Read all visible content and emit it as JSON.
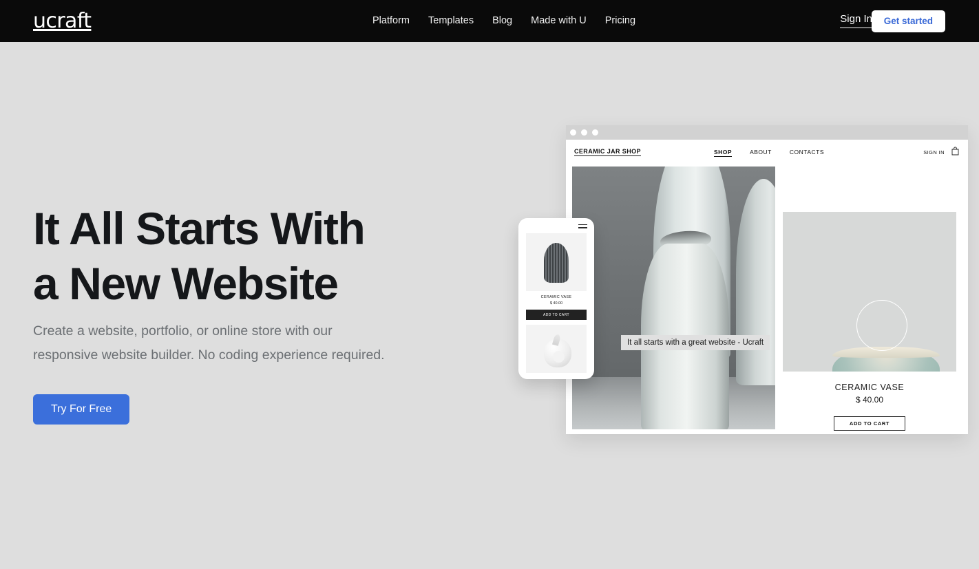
{
  "nav": {
    "logo": "ucraft",
    "links": [
      {
        "label": "Platform"
      },
      {
        "label": "Templates"
      },
      {
        "label": "Blog"
      },
      {
        "label": "Made with U"
      },
      {
        "label": "Pricing"
      }
    ],
    "sign_in": "Sign In",
    "get_started": "Get started",
    "bg_color": "#0a0a0a",
    "accent_color": "#3767d6"
  },
  "hero": {
    "heading_line1": "It All Starts With",
    "heading_line2": "a New Website",
    "subheading_line1": "Create a website, portfolio, or online store with our",
    "subheading_line2": "responsive website builder. No coding experience required.",
    "cta": "Try For Free",
    "cta_color": "#3b6fdb",
    "background_color": "#dedede"
  },
  "browser_mockup": {
    "site_title": "CERAMIC JAR SHOP",
    "nav": [
      {
        "label": "SHOP",
        "active": true
      },
      {
        "label": "ABOUT",
        "active": false
      },
      {
        "label": "CONTACTS",
        "active": false
      }
    ],
    "sign_in": "SIGN IN",
    "cart_icon": "shopping-bag-icon",
    "photo_caption": "It all starts with a great website - Ucraft",
    "product": {
      "name": "CERAMIC VASE",
      "price": "$ 40.00",
      "add_to_cart": "ADD TO CART"
    }
  },
  "phone_mockup": {
    "menu_icon": "hamburger-menu-icon",
    "product": {
      "name": "CERAMIC VASE",
      "price": "$ 40.00",
      "add_to_cart": "ADD TO CART"
    }
  }
}
